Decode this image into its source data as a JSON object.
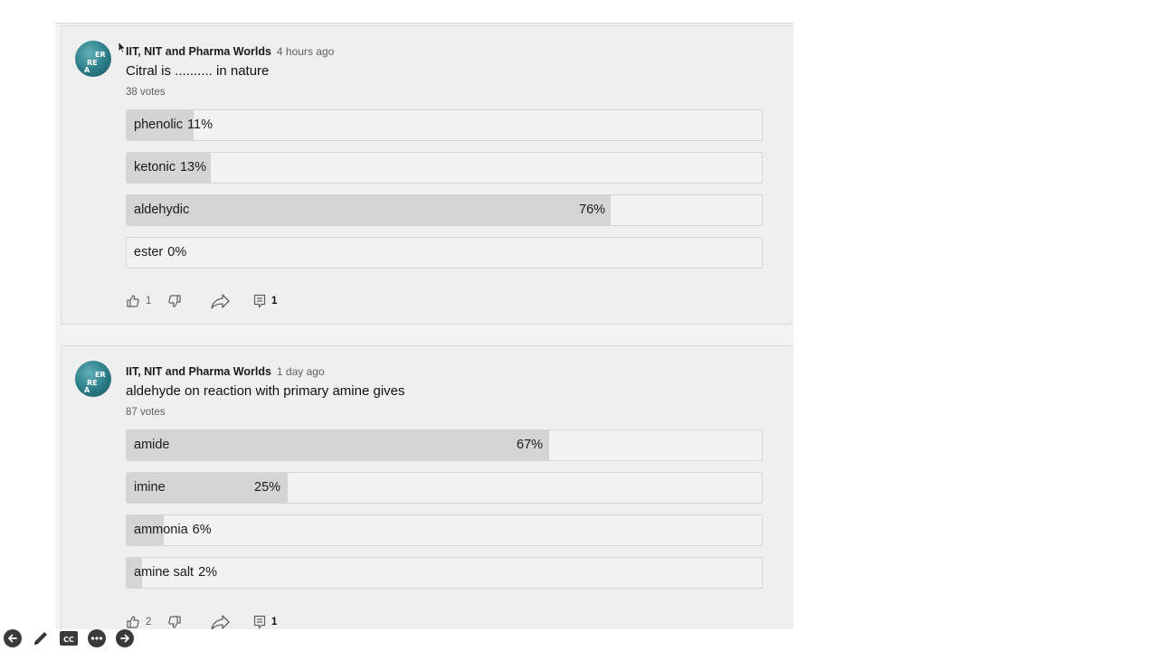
{
  "posts": [
    {
      "avatar_icon": "channel-avatar-icon",
      "avatar_letters": [
        "ER",
        "RE",
        "A"
      ],
      "author": "IIT, NIT and Pharma Worlds",
      "time": "4 hours ago",
      "question": "Citral is .......... in nature",
      "votes": "38 votes",
      "options": [
        {
          "label": "phenolic",
          "percent": "11%",
          "fill": 0.105
        },
        {
          "label": "ketonic",
          "percent": "13%",
          "fill": 0.132
        },
        {
          "label": "aldehydic",
          "percent": "76%",
          "fill": 0.762
        },
        {
          "label": "ester",
          "percent": "0%",
          "fill": 0
        }
      ],
      "likes": "1",
      "comments": "1"
    },
    {
      "avatar_icon": "channel-avatar-icon",
      "avatar_letters": [
        "ER",
        "RE",
        "A"
      ],
      "author": "IIT, NIT and Pharma Worlds",
      "time": "1 day ago",
      "question": "aldehyde on reaction with primary amine gives",
      "votes": "87 votes",
      "options": [
        {
          "label": "amide",
          "percent": "67%",
          "fill": 0.665
        },
        {
          "label": "imine",
          "percent": "25%",
          "fill": 0.254
        },
        {
          "label": "ammonia",
          "percent": "6%",
          "fill": 0.058
        },
        {
          "label": "amine salt",
          "percent": "2%",
          "fill": 0.024
        }
      ],
      "likes": "2",
      "comments": "1"
    }
  ],
  "player_toolbar": {
    "cc_label": "CC",
    "icons": [
      "back-arrow-icon",
      "pen-icon",
      "closed-captions-icon",
      "more-options-icon",
      "forward-arrow-icon"
    ]
  },
  "colors": {
    "fill": "#d4d4d4",
    "option_bg": "#f2f2f2",
    "avatar": "#2a7b86"
  }
}
